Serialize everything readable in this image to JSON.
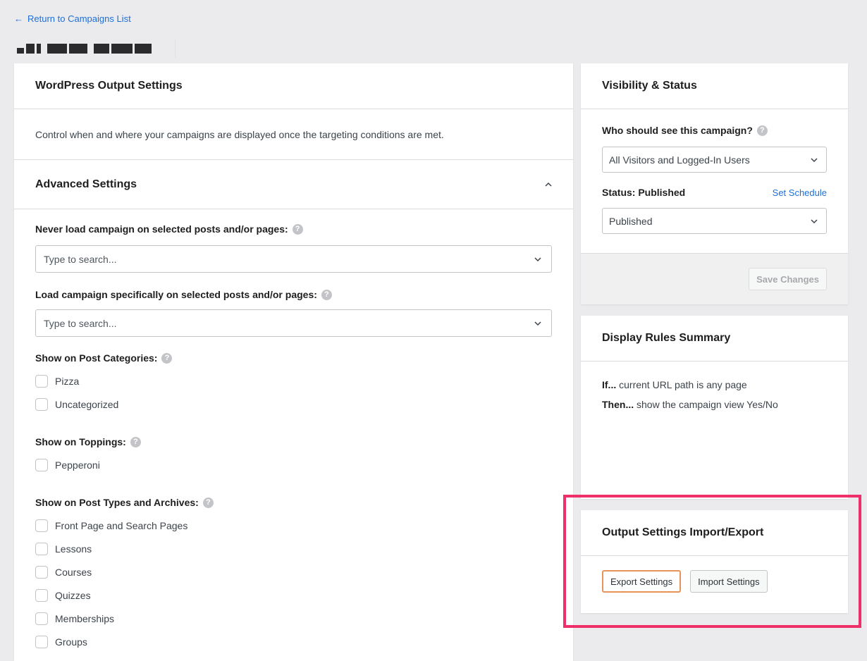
{
  "header": {
    "back_link": "Return to Campaigns List",
    "back_icon": "arrow-left-icon",
    "page_title": "[obscured campaign name]"
  },
  "output_settings": {
    "title": "WordPress Output Settings",
    "description": "Control when and where your campaigns are displayed once the targeting conditions are met."
  },
  "advanced": {
    "title": "Advanced Settings",
    "toggle_icon": "chevron-up-icon",
    "never_load_label": "Never load campaign on selected posts and/or pages:",
    "never_load_placeholder": "Type to search...",
    "load_specific_label": "Load campaign specifically on selected posts and/or pages:",
    "load_specific_placeholder": "Type to search...",
    "categories_label": "Show on Post Categories:",
    "categories": [
      {
        "label": "Pizza",
        "checked": false
      },
      {
        "label": "Uncategorized",
        "checked": false
      }
    ],
    "toppings_label": "Show on Toppings:",
    "toppings": [
      {
        "label": "Pepperoni",
        "checked": false
      }
    ],
    "post_types_label": "Show on Post Types and Archives:",
    "post_types": [
      {
        "label": "Front Page and Search Pages",
        "checked": false
      },
      {
        "label": "Lessons",
        "checked": false
      },
      {
        "label": "Courses",
        "checked": false
      },
      {
        "label": "Quizzes",
        "checked": false
      },
      {
        "label": "Memberships",
        "checked": false
      },
      {
        "label": "Groups",
        "checked": false
      }
    ],
    "help_glyph": "?"
  },
  "visibility": {
    "title": "Visibility & Status",
    "who_label": "Who should see this campaign?",
    "who_value": "All Visitors and Logged-In Users",
    "status_label": "Status: Published",
    "set_schedule": "Set Schedule",
    "status_value": "Published",
    "save_button": "Save Changes"
  },
  "rules_summary": {
    "title": "Display Rules Summary",
    "if_prefix": "If...",
    "if_text": " current URL path is any page",
    "then_prefix": "Then...",
    "then_text": " show the campaign view Yes/No"
  },
  "import_export": {
    "title": "Output Settings Import/Export",
    "export_button": "Export Settings",
    "import_button": "Import Settings",
    "highlight_color": "#ee2f6a"
  }
}
